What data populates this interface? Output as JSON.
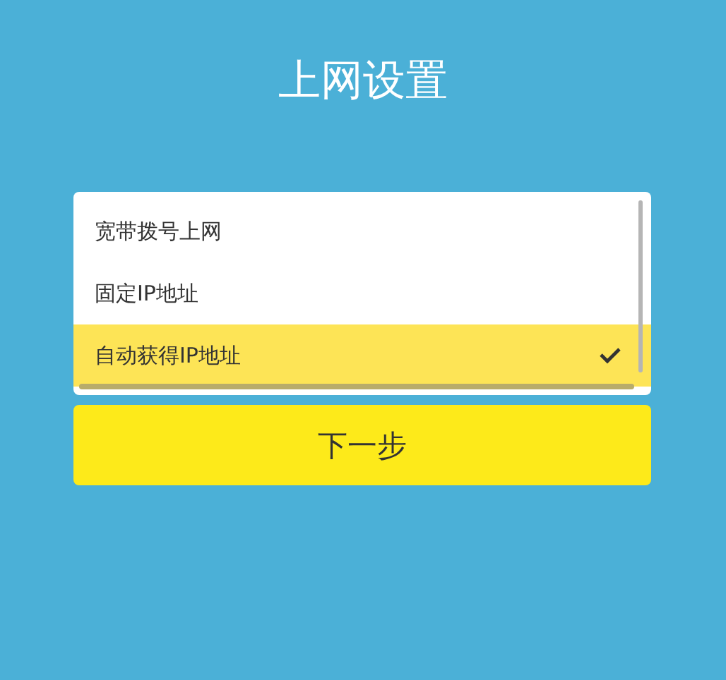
{
  "title": "上网设置",
  "options": [
    {
      "label": "宽带拨号上网",
      "selected": false
    },
    {
      "label": "固定IP地址",
      "selected": false
    },
    {
      "label": "自动获得IP地址",
      "selected": true
    }
  ],
  "next_button": "下一步"
}
